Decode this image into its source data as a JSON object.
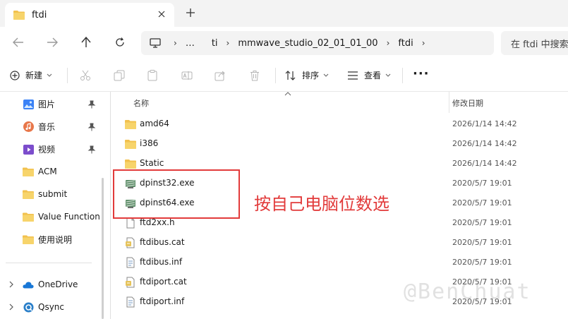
{
  "tab": {
    "title": "ftdi",
    "close": "✕",
    "new": "+"
  },
  "nav": {
    "crumbs": [
      "…",
      "ti",
      "mmwave_studio_02_01_01_00",
      "ftdi"
    ],
    "search_placeholder": "在 ftdi 中搜索"
  },
  "toolbar": {
    "new_label": "新建",
    "sort_label": "排序",
    "view_label": "查看",
    "more_label": "···"
  },
  "sidebar": {
    "items": [
      {
        "label": "图片",
        "icon": "pictures-icon",
        "pinned": true
      },
      {
        "label": "音乐",
        "icon": "music-icon",
        "pinned": true
      },
      {
        "label": "视频",
        "icon": "videos-icon",
        "pinned": true
      },
      {
        "label": "ACM",
        "icon": "folder-icon",
        "pinned": false
      },
      {
        "label": "submit",
        "icon": "folder-icon",
        "pinned": false
      },
      {
        "label": "Value Function",
        "icon": "folder-icon",
        "pinned": false
      },
      {
        "label": "使用说明",
        "icon": "folder-icon",
        "pinned": false
      }
    ],
    "drives": [
      {
        "label": "OneDrive",
        "icon": "onedrive-icon"
      },
      {
        "label": "Qsync",
        "icon": "qsync-icon"
      }
    ]
  },
  "columns": {
    "name": "名称",
    "modified": "修改日期"
  },
  "files": [
    {
      "name": "amd64",
      "date": "2026/1/14 14:42",
      "type": "folder"
    },
    {
      "name": "i386",
      "date": "2026/1/14 14:42",
      "type": "folder"
    },
    {
      "name": "Static",
      "date": "2026/1/14 14:42",
      "type": "folder"
    },
    {
      "name": "dpinst32.exe",
      "date": "2020/5/7 19:01",
      "type": "exe"
    },
    {
      "name": "dpinst64.exe",
      "date": "2020/5/7 19:01",
      "type": "exe"
    },
    {
      "name": "ftd2xx.h",
      "date": "2020/5/7 19:01",
      "type": "h"
    },
    {
      "name": "ftdibus.cat",
      "date": "2020/5/7 19:01",
      "type": "cat"
    },
    {
      "name": "ftdibus.inf",
      "date": "2020/5/7 19:01",
      "type": "inf"
    },
    {
      "name": "ftdiport.cat",
      "date": "2020/5/7 19:01",
      "type": "cat"
    },
    {
      "name": "ftdiport.inf",
      "date": "2020/5/7 19:01",
      "type": "inf"
    }
  ],
  "annotation": "按自己电脑位数选",
  "watermark": "@BenChuat",
  "colors": {
    "accent": "#e23b3b",
    "folder": "#f2c14e"
  }
}
